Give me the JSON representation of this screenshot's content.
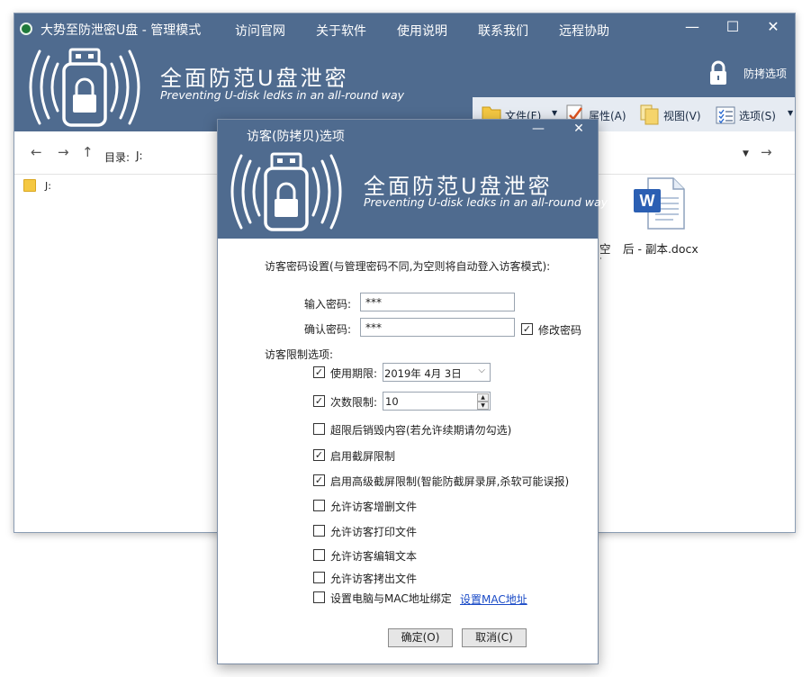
{
  "main_window": {
    "title": "大势至防泄密U盘 - 管理模式",
    "menu": [
      "访问官网",
      "关于软件",
      "使用说明",
      "联系我们",
      "远程协助"
    ],
    "controls": {
      "minimize": "—",
      "maximize": "☐",
      "close": "✕"
    },
    "brand_cn": "全面防范U盘泄密",
    "brand_en": "Preventing U-disk ledks in an all-round way",
    "antishot_label": "防拷选项",
    "toolbar": {
      "file": "文件(F)",
      "properties": "属性(A)",
      "view": "视图(V)",
      "options": "选项(S)"
    },
    "nav": {
      "path_label": "目录:",
      "path_value": "J:"
    },
    "tree": {
      "root_label": "J:"
    },
    "files": {
      "word_label": "后 - 副本.docx",
      "cut_label": "空",
      "cut_dot": "·"
    }
  },
  "dialog": {
    "title": "访客(防拷贝)选项",
    "controls": {
      "minimize": "—",
      "close": "✕"
    },
    "brand_cn": "全面防范U盘泄密",
    "brand_en": "Preventing U-disk ledks in an all-round way",
    "password_section_label": "访客密码设置(与管理密码不同,为空则将自动登入访客模式):",
    "password_label": "输入密码:",
    "password_value": "***",
    "confirm_label": "确认密码:",
    "confirm_value": "***",
    "change_password_label": "修改密码",
    "change_password_checked": true,
    "limits_section_label": "访客限制选项:",
    "expiry": {
      "label": "使用期限:",
      "checked": true,
      "value": "2019年 4月 3日"
    },
    "count_limit": {
      "label": "次数限制:",
      "checked": true,
      "value": "10"
    },
    "options": [
      {
        "label": "超限后销毁内容(若允许续期请勿勾选)",
        "checked": false
      },
      {
        "label": "启用截屏限制",
        "checked": true
      },
      {
        "label": "启用高级截屏限制(智能防截屏录屏,杀软可能误报)",
        "checked": true
      },
      {
        "label": "允许访客增删文件",
        "checked": false
      },
      {
        "label": "允许访客打印文件",
        "checked": false
      },
      {
        "label": "允许访客编辑文本",
        "checked": false
      },
      {
        "label": "允许访客拷出文件",
        "checked": false
      },
      {
        "label": "设置电脑与MAC地址绑定",
        "checked": false
      }
    ],
    "mac_link": "设置MAC地址",
    "ok_button": "确定(O)",
    "cancel_button": "取消(C)"
  }
}
